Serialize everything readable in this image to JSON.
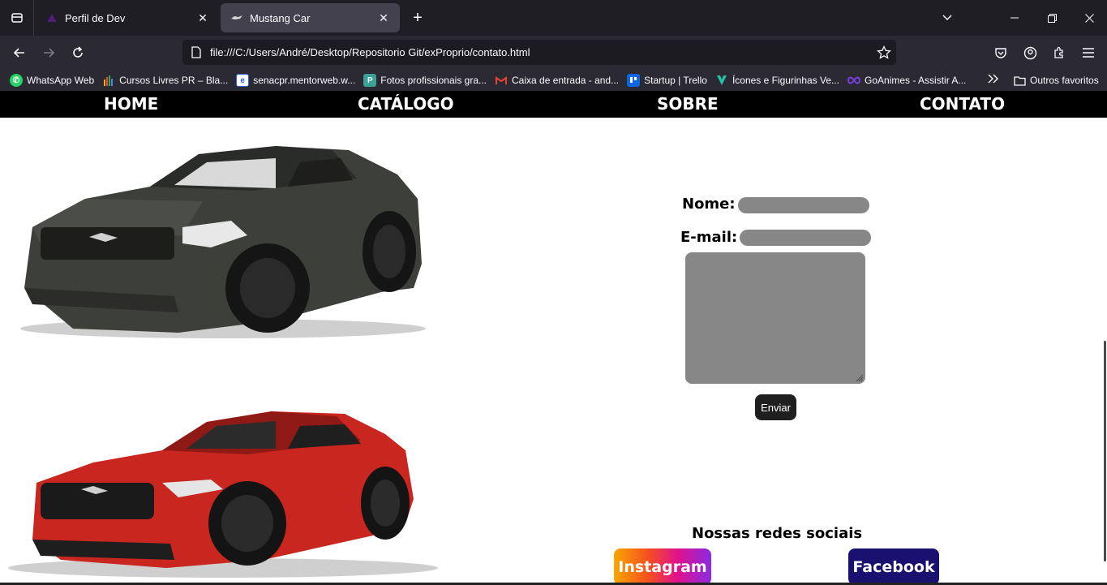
{
  "browser": {
    "tabs": [
      {
        "title": "Perfil de Dev",
        "active": false
      },
      {
        "title": "Mustang Car",
        "active": true
      }
    ],
    "url": "file:///C:/Users/André/Desktop/Repositorio Git/exProprio/contato.html",
    "bookmarks": [
      {
        "label": "WhatsApp Web",
        "icon": "whatsapp-icon",
        "color": "#25d366"
      },
      {
        "label": "Cursos Livres PR – Bla...",
        "icon": "bar-chart-icon",
        "color": "#f5a623"
      },
      {
        "label": "senacpr.mentorweb.w...",
        "icon": "e-icon",
        "color": "#2b63d9"
      },
      {
        "label": "Fotos profissionais gra...",
        "icon": "photo-icon",
        "color": "#3aa197"
      },
      {
        "label": "Caixa de entrada - and...",
        "icon": "gmail-icon",
        "color": "#ea4335"
      },
      {
        "label": "Startup | Trello",
        "icon": "trello-icon",
        "color": "#0c66e4"
      },
      {
        "label": "Ícones e Figurinhas Ve...",
        "icon": "vector-icon",
        "color": "#22c3a6"
      },
      {
        "label": "GoAnimes - Assistir A...",
        "icon": "infinity-icon",
        "color": "#7b3fe4"
      }
    ],
    "other_bookmarks": "Outros favoritos"
  },
  "site": {
    "nav": [
      "HOME",
      "CATÁLOGO",
      "SOBRE",
      "CONTATO"
    ],
    "form": {
      "name_label": "Nome:",
      "email_label": "E-mail:",
      "send_label": "Enviar"
    },
    "social": {
      "title": "Nossas redes sociais",
      "instagram": "Instagram",
      "facebook": "Facebook"
    }
  }
}
